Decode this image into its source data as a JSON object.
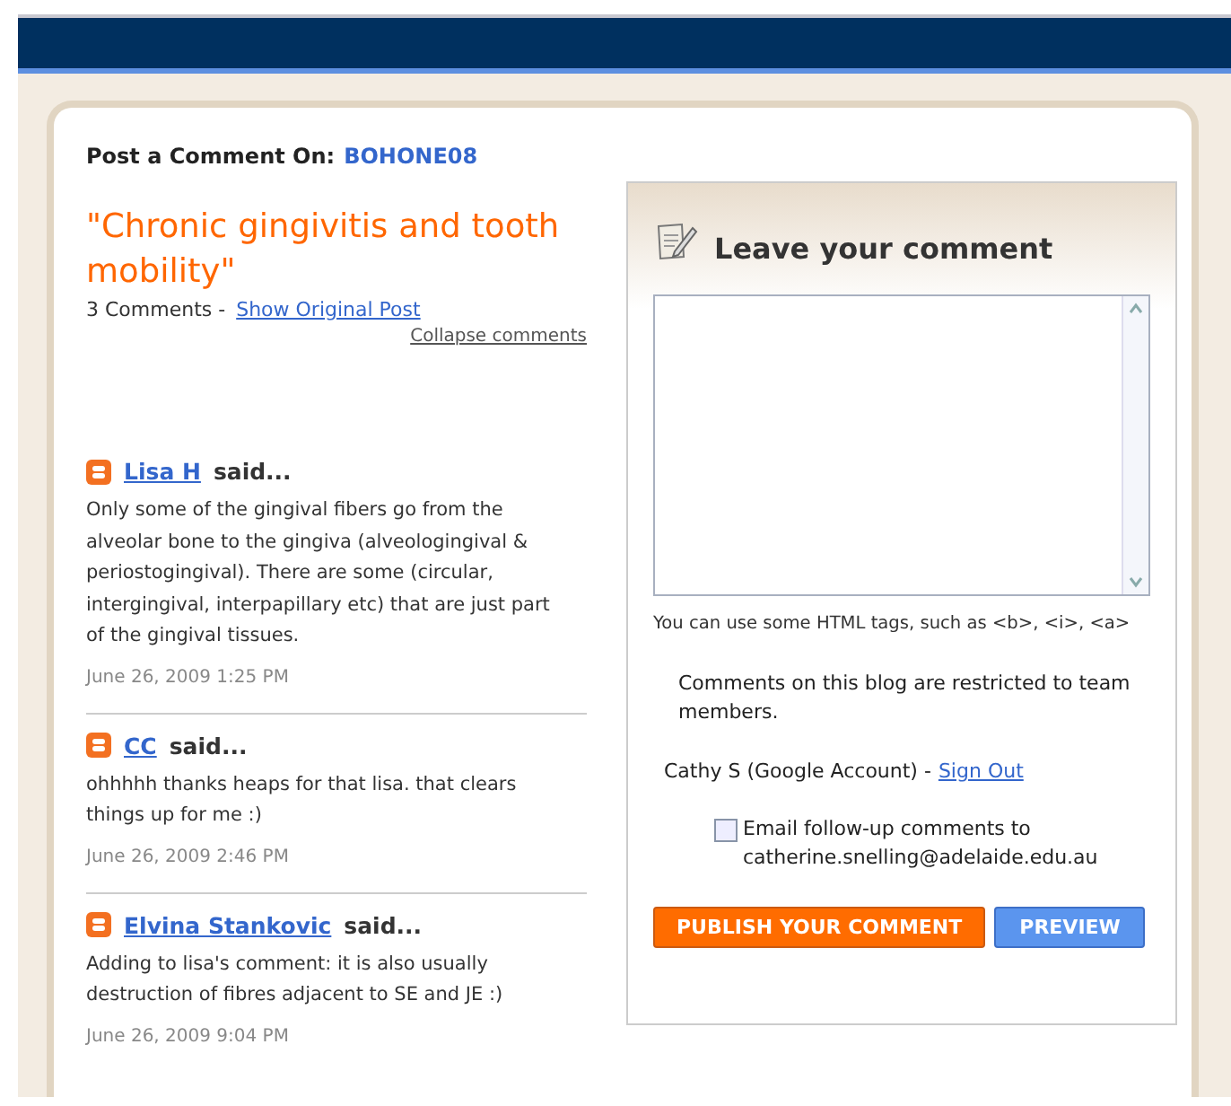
{
  "header": {
    "label": "Post a Comment On:",
    "blog_name": "BOHONE08"
  },
  "post": {
    "title": "\"Chronic gingivitis and tooth mobility\"",
    "comment_count": "3 Comments -",
    "show_original": "Show Original Post",
    "collapse": "Collapse comments"
  },
  "comments": [
    {
      "author": "Lisa H",
      "said": "said...",
      "body": "Only some of the gingival fibers go from the alveolar bone to the gingiva (alveologingival & periostogingival).  There are some (circular, intergingival, interpapillary etc) that are just part of the gingival tissues.",
      "time": "June 26, 2009 1:25 PM"
    },
    {
      "author": "CC",
      "said": "said...",
      "body": "ohhhhh thanks heaps for that lisa. that clears things up for me :)",
      "time": "June 26, 2009 2:46 PM"
    },
    {
      "author": "Elvina Stankovic",
      "said": "said...",
      "body": "Adding to lisa's comment: it is also usually destruction of fibres adjacent to SE and JE :)",
      "time": "June 26, 2009 9:04 PM"
    }
  ],
  "form": {
    "heading": "Leave your comment",
    "html_hint": "You can use some HTML tags, such as <b>, <i>, <a>",
    "restriction": "Comments on this blog are restricted to team members.",
    "account": "Cathy S (Google Account) -",
    "sign_out": "Sign Out",
    "email_followup": {
      "label": "Email follow-up comments to",
      "email": "catherine.snelling@adelaide.edu.au",
      "checked": false
    },
    "publish": "PUBLISH YOUR COMMENT",
    "preview": "PREVIEW"
  }
}
